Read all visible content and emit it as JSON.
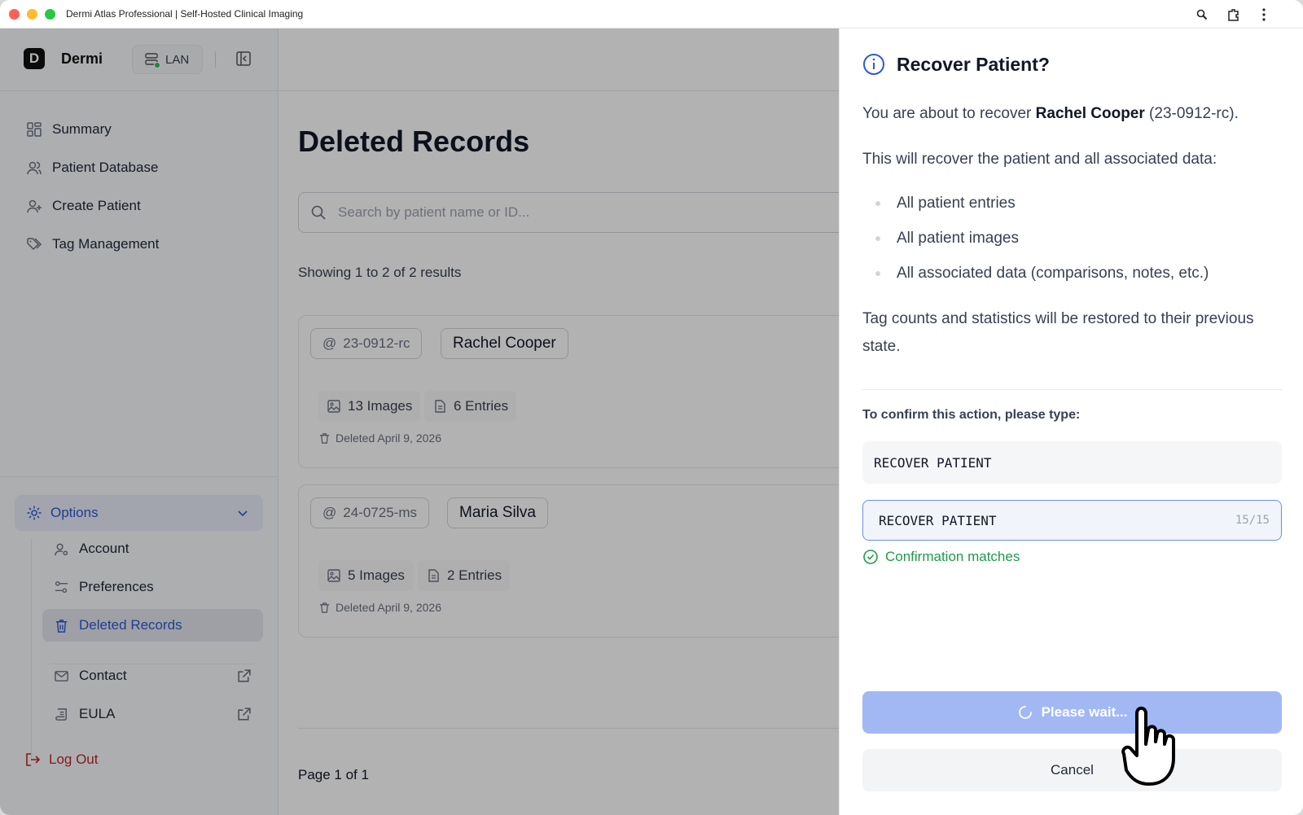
{
  "window": {
    "title": "Dermi Atlas Professional | Self-Hosted Clinical Imaging"
  },
  "sidebar": {
    "logo_letter": "D",
    "brand": "Dermi",
    "network_badge": "LAN",
    "nav": [
      {
        "label": "Summary",
        "icon": "grid-icon"
      },
      {
        "label": "Patient Database",
        "icon": "users-icon"
      },
      {
        "label": "Create Patient",
        "icon": "user-plus-icon"
      },
      {
        "label": "Tag Management",
        "icon": "tags-icon"
      }
    ],
    "options_label": "Options",
    "options_items": [
      {
        "label": "Account",
        "icon": "user-cog-icon"
      },
      {
        "label": "Preferences",
        "icon": "sliders-icon"
      },
      {
        "label": "Deleted Records",
        "icon": "trash-icon",
        "active": true
      },
      {
        "label": "Contact",
        "icon": "mail-icon"
      },
      {
        "label": "EULA",
        "icon": "scroll-icon"
      }
    ],
    "logout_label": "Log Out"
  },
  "main": {
    "title": "Deleted Records",
    "search_placeholder": "Search by patient name or ID...",
    "results_text": "Showing 1 to 2 of 2 results",
    "records": [
      {
        "id": "23-0912-rc",
        "name": "Rachel Cooper",
        "images": "13 Images",
        "entries": "6 Entries",
        "deleted": "Deleted April 9, 2026"
      },
      {
        "id": "24-0725-ms",
        "name": "Maria Silva",
        "images": "5 Images",
        "entries": "2 Entries",
        "deleted": "Deleted April 9, 2026"
      }
    ],
    "page_info": "Page 1 of 1"
  },
  "dialog": {
    "title": "Recover Patient?",
    "intro_prefix": "You are about to recover ",
    "patient_name": "Rachel Cooper",
    "patient_id": " (23-0912-rc).",
    "lead": "This will recover the patient and all associated data:",
    "bullets": [
      "All patient entries",
      "All patient images",
      "All associated data (comparisons, notes, etc.)"
    ],
    "note": "Tag counts and statistics will be restored to their previous state.",
    "confirm_label": "To confirm this action, please type:",
    "confirm_phrase": "RECOVER PATIENT",
    "input_value": "RECOVER PATIENT",
    "counter": "15/15",
    "match_text": "Confirmation matches",
    "primary_label": "Please wait...",
    "cancel_label": "Cancel"
  },
  "colors": {
    "accent": "#2c5ad1",
    "success": "#1f9a4a",
    "danger": "#c0262d",
    "primary_disabled": "#a2b8f5"
  }
}
